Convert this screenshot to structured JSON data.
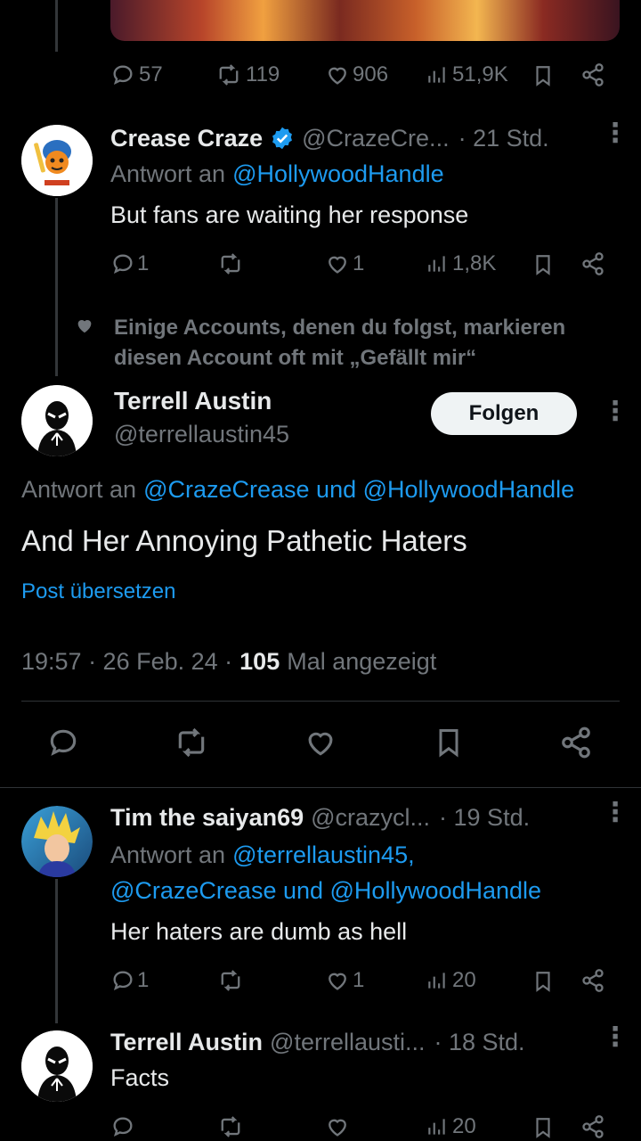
{
  "top_post": {
    "actions": {
      "replies": "57",
      "reposts": "119",
      "likes": "906",
      "views": "51,9K"
    }
  },
  "reply1": {
    "name": "Crease Craze",
    "handle": "@CrazeCre...",
    "time": "· 21 Std.",
    "reply_prefix": "Antwort an",
    "reply_to": "@HollywoodHandle",
    "text": "But fans are waiting her response",
    "actions": {
      "replies": "1",
      "reposts": "",
      "likes": "1",
      "views": "1,8K"
    }
  },
  "social_context": {
    "text": "Einige Accounts, denen du folgst, markieren diesen Account oft mit „Gefällt mir“"
  },
  "main_post": {
    "name": "Terrell Austin",
    "handle": "@terrellaustin45",
    "follow_label": "Folgen",
    "reply_prefix": "Antwort an",
    "reply_to": "@CrazeCrease und @HollywoodHandle",
    "text": "And Her Annoying Pathetic Haters",
    "translate": "Post übersetzen",
    "timestamp": "19:57 · 26 Feb. 24 ·",
    "views_count": "105",
    "views_label": "Mal angezeigt"
  },
  "reply2": {
    "name": "Tim the saiyan69",
    "handle": "@crazycl...",
    "time": "· 19 Std.",
    "reply_prefix": "Antwort an",
    "reply_to_line1": "@terrellaustin45,",
    "reply_to_line2": "@CrazeCrease und @HollywoodHandle",
    "text": "Her haters are dumb as hell",
    "actions": {
      "replies": "1",
      "reposts": "",
      "likes": "1",
      "views": "20"
    }
  },
  "reply3": {
    "name": "Terrell Austin",
    "handle": "@terrellausti...",
    "time": "· 18 Std.",
    "text": "Facts",
    "actions": {
      "replies": "",
      "reposts": "",
      "likes": "",
      "views": "20"
    }
  },
  "colors": {
    "background": "#000000",
    "text": "#e7e9ea",
    "muted": "#71767b",
    "link": "#1d9bf0",
    "verified": "#1d9bf0"
  }
}
